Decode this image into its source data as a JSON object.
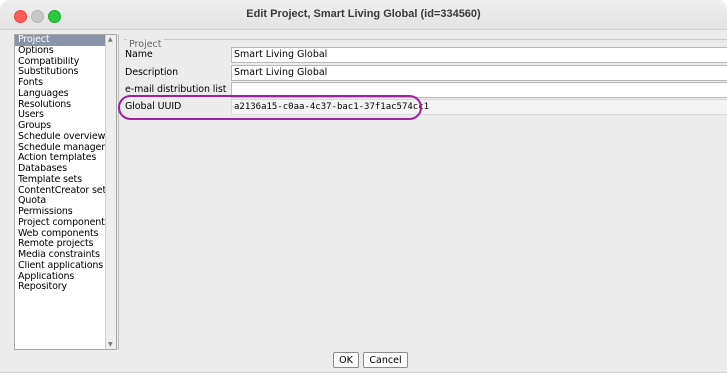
{
  "window": {
    "title": "Edit Project, Smart Living Global (id=334560)"
  },
  "sidebar": {
    "items": [
      {
        "label": "Project",
        "selected": true
      },
      {
        "label": "Options"
      },
      {
        "label": "Compatibility"
      },
      {
        "label": "Substitutions"
      },
      {
        "label": "Fonts"
      },
      {
        "label": "Languages"
      },
      {
        "label": "Resolutions"
      },
      {
        "label": "Users"
      },
      {
        "label": "Groups"
      },
      {
        "label": "Schedule overview"
      },
      {
        "label": "Schedule management"
      },
      {
        "label": "Action templates"
      },
      {
        "label": "Databases"
      },
      {
        "label": "Template sets"
      },
      {
        "label": "ContentCreator settings"
      },
      {
        "label": "Quota"
      },
      {
        "label": "Permissions"
      },
      {
        "label": "Project components"
      },
      {
        "label": "Web components"
      },
      {
        "label": "Remote projects"
      },
      {
        "label": "Media constraints"
      },
      {
        "label": "Client applications"
      },
      {
        "label": "Applications"
      },
      {
        "label": "Repository"
      }
    ]
  },
  "project": {
    "group_label": "Project",
    "fields": [
      {
        "label": "Name",
        "value": "Smart Living Global"
      },
      {
        "label": "Description",
        "value": "Smart Living Global"
      },
      {
        "label": "e-mail distribution list",
        "value": ""
      },
      {
        "label": "Global UUID",
        "value": "a2136a15-c0aa-4c37-bac1-37f1ac574cc1"
      }
    ]
  },
  "buttons": {
    "ok": "OK",
    "cancel": "Cancel"
  },
  "colors": {
    "highlight": "#a020a0",
    "selection": "#8a94a8"
  }
}
